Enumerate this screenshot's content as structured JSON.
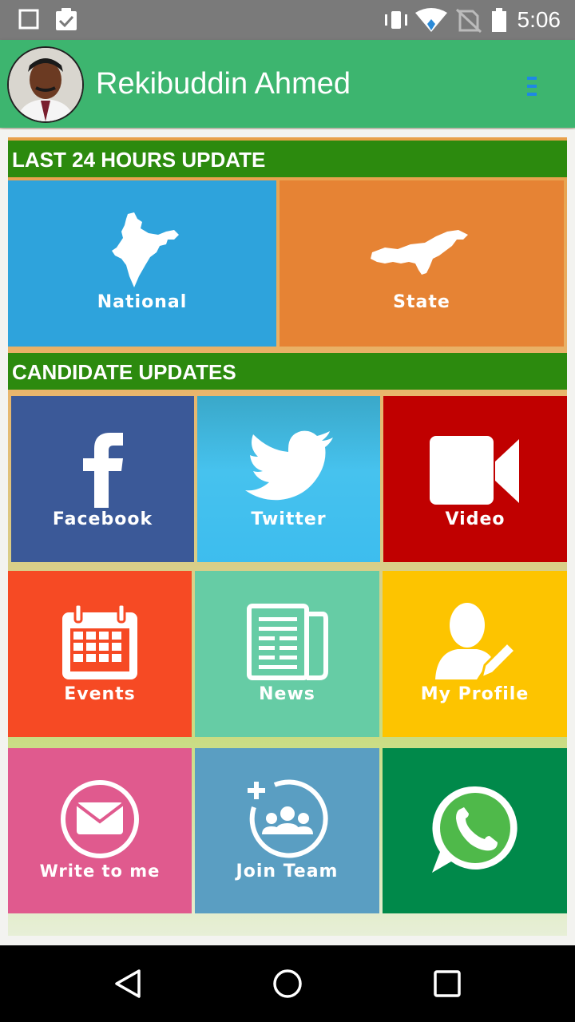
{
  "status_bar": {
    "time": "5:06",
    "icons": [
      "square-icon",
      "clipboard-check-icon",
      "vibrate-icon",
      "wifi-icon",
      "no-sim-icon",
      "battery-icon"
    ]
  },
  "app_bar": {
    "title": "Rekibuddin Ahmed",
    "menu_icon": "menu-icon"
  },
  "sections": {
    "last24": "LAST 24 HOURS UPDATE",
    "candidate": "CANDIDATE UPDATES"
  },
  "tiles": {
    "national": {
      "label": "National",
      "icon": "india-map-icon",
      "color": "#2ea3dc"
    },
    "state": {
      "label": "State",
      "icon": "assam-map-icon",
      "color": "#e68334"
    },
    "facebook": {
      "label": "Facebook",
      "icon": "facebook-icon",
      "color": "#3b5998"
    },
    "twitter": {
      "label": "Twitter",
      "icon": "twitter-icon",
      "color": "#41bde9"
    },
    "video": {
      "label": "Video",
      "icon": "video-camera-icon",
      "color": "#c00000"
    },
    "events": {
      "label": "Events",
      "icon": "calendar-icon",
      "color": "#f64a24"
    },
    "news": {
      "label": "News",
      "icon": "newspaper-icon",
      "color": "#66cca5"
    },
    "profile": {
      "label": "My Profile",
      "icon": "user-edit-icon",
      "color": "#fdc400"
    },
    "write": {
      "label": "Write to me",
      "icon": "envelope-icon",
      "color": "#e05a8e"
    },
    "join": {
      "label": "Join Team",
      "icon": "add-group-icon",
      "color": "#5a9ec2"
    },
    "whatsapp": {
      "label": "",
      "icon": "whatsapp-icon",
      "color": "#00894a"
    }
  },
  "nav_bar": {
    "back": "back-icon",
    "home": "home-icon",
    "recents": "recents-icon"
  }
}
